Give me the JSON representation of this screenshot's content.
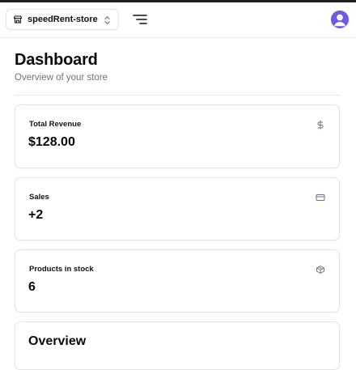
{
  "navbar": {
    "store_switcher": {
      "icon": "store-icon",
      "label": "speedRent-store",
      "chevron_icon": "chevrons-up-down-icon"
    },
    "menu_icon": "menu-icon",
    "avatar_icon": "user-avatar-icon"
  },
  "page": {
    "title": "Dashboard",
    "subtitle": "Overview of your store"
  },
  "cards": {
    "revenue": {
      "label": "Total Revenue",
      "value": "$128.00",
      "icon": "dollar-icon"
    },
    "sales": {
      "label": "Sales",
      "value": "+2",
      "icon": "credit-card-icon"
    },
    "stock": {
      "label": "Products in stock",
      "value": "6",
      "icon": "package-icon"
    }
  },
  "overview": {
    "title": "Overview"
  },
  "colors": {
    "avatar": "#6d5ae6",
    "border": "#e4e4e7",
    "muted_text": "#6b7280"
  }
}
